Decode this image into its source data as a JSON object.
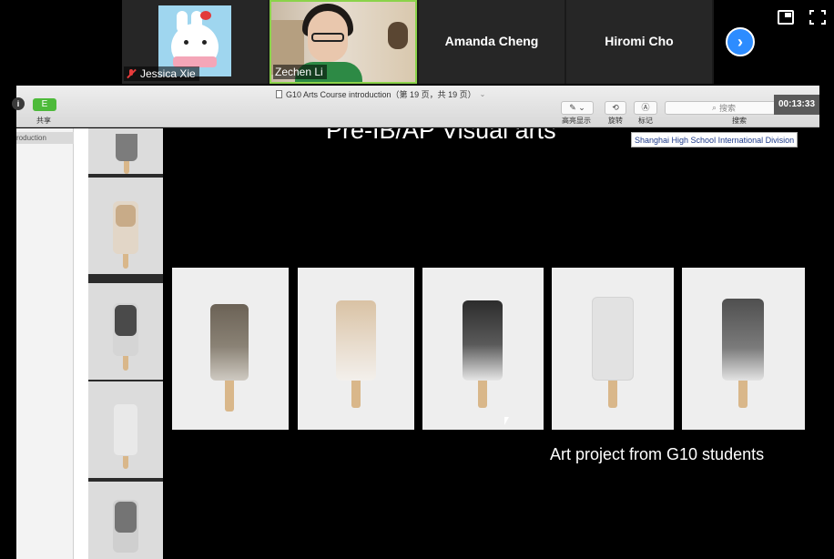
{
  "participants": [
    {
      "name": "Jessica Xie",
      "muted": true,
      "avatar": "bunny-avatar"
    },
    {
      "name": "Zechen Li",
      "muted": true,
      "active_speaker": true,
      "video": "webcam"
    },
    {
      "name": "Amanda Cheng",
      "video": false
    },
    {
      "name": "Hiromi Cho",
      "video": false
    }
  ],
  "controls": {
    "next_icon": "chevron-right-icon",
    "next_glyph": "›",
    "pip_icon": "picture-in-picture-icon",
    "fullscreen_icon": "fullscreen-icon"
  },
  "viewer": {
    "doc_title": "G10  Arts Course introduction（第 19 页，共 19 页）",
    "share_label": "共享",
    "share_glyph": "E",
    "info_glyph": "i",
    "toolbar": [
      {
        "label": "高亮显示",
        "icon": "highlighter-icon"
      },
      {
        "label": "旋转",
        "icon": "rotate-icon"
      },
      {
        "label": "标记",
        "icon": "markup-icon"
      }
    ],
    "search_placeholder": "搜索",
    "search_label": "搜索",
    "timer": "00:13:33",
    "sidebar_item": "roduction"
  },
  "slide": {
    "title": "Pre-IB/AP Visual arts",
    "badge": "Shanghai High School International Division",
    "caption": "Art project from G10 students",
    "photo_count": 5
  },
  "colors": {
    "active_border": "#8bd34a",
    "accent_blue": "#2d8cff",
    "muted_red": "#e53b3b",
    "share_green": "#4dba3a"
  }
}
